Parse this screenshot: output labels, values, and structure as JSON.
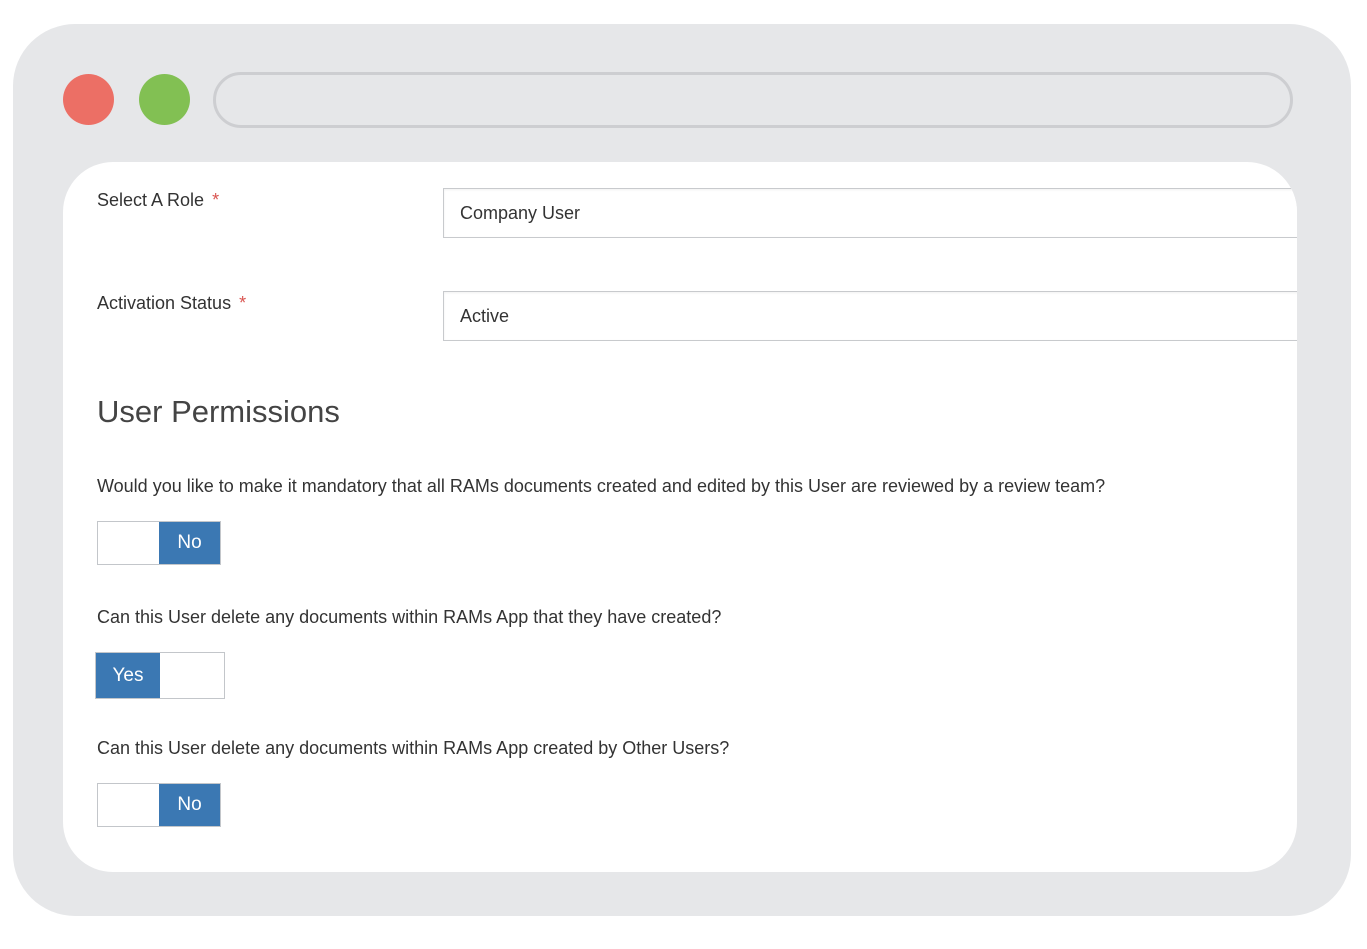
{
  "form": {
    "role": {
      "label": "Select A Role",
      "required_mark": "*",
      "value": "Company User"
    },
    "activation": {
      "label": "Activation Status",
      "required_mark": "*",
      "value": "Active"
    }
  },
  "permissions": {
    "title": "User Permissions",
    "items": [
      {
        "question": "Would you like to make it mandatory that all RAMs documents created and edited by this User are reviewed by a review team?",
        "value": "No"
      },
      {
        "question": "Can this User delete any documents within RAMs App that they have created?",
        "value": "Yes"
      },
      {
        "question": "Can this User delete any documents within RAMs App created by Other Users?",
        "value": "No"
      }
    ]
  },
  "colors": {
    "frame": "#e6e7e9",
    "dot_red": "#ec6f65",
    "dot_green": "#82c053",
    "toggle_active": "#3b78b3",
    "required": "#d9534f"
  }
}
